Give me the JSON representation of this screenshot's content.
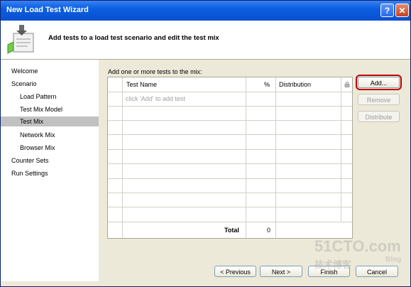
{
  "window": {
    "title": "New Load Test Wizard",
    "help": "?",
    "close": "✕"
  },
  "header": {
    "text": "Add tests to a load test scenario and edit the test mix"
  },
  "nav": {
    "items": [
      {
        "label": "Welcome"
      },
      {
        "label": "Scenario"
      },
      {
        "label": "Load Pattern"
      },
      {
        "label": "Test Mix Model"
      },
      {
        "label": "Test Mix"
      },
      {
        "label": "Network Mix"
      },
      {
        "label": "Browser Mix"
      },
      {
        "label": "Counter Sets"
      },
      {
        "label": "Run Settings"
      }
    ]
  },
  "grid": {
    "label": "Add one or more tests to the mix:",
    "columns": {
      "name": "Test Name",
      "percent": "%",
      "distribution": "Distribution"
    },
    "placeholder": "click 'Add' to add test",
    "total_label": "Total",
    "total_value": "0"
  },
  "buttons": {
    "add": "Add...",
    "remove": "Remove",
    "distribute": "Distribute",
    "previous": "< Previous",
    "next": "Next >",
    "finish": "Finish",
    "cancel": "Cancel"
  },
  "watermark": {
    "site": "51CTO.com",
    "sub": "技术博客",
    "blog": "Blog"
  }
}
